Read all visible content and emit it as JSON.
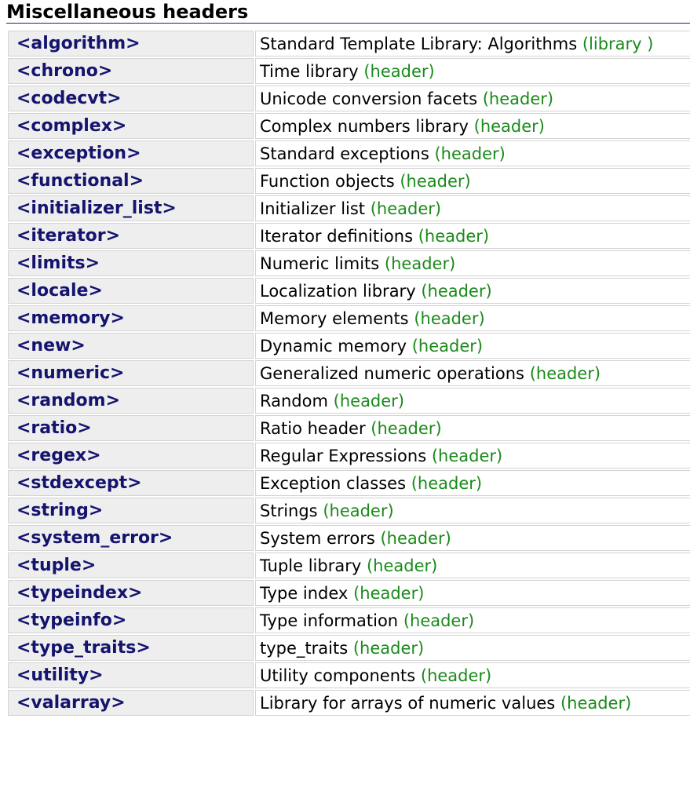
{
  "section": {
    "title": "Miscellaneous headers"
  },
  "colors": {
    "name_text": "#14146e",
    "kind_text": "#1a8a1a",
    "name_cell_bg": "#eeeeee",
    "cell_border": "#d3d3d3"
  },
  "rows": [
    {
      "name": "<algorithm>",
      "description": "Standard Template Library: Algorithms",
      "kind": "(library )"
    },
    {
      "name": "<chrono>",
      "description": "Time library",
      "kind": "(header)"
    },
    {
      "name": "<codecvt>",
      "description": "Unicode conversion facets",
      "kind": "(header)"
    },
    {
      "name": "<complex>",
      "description": "Complex numbers library",
      "kind": "(header)"
    },
    {
      "name": "<exception>",
      "description": "Standard exceptions",
      "kind": "(header)"
    },
    {
      "name": "<functional>",
      "description": "Function objects",
      "kind": "(header)"
    },
    {
      "name": "<initializer_list>",
      "description": "Initializer list",
      "kind": "(header)"
    },
    {
      "name": "<iterator>",
      "description": "Iterator definitions",
      "kind": "(header)"
    },
    {
      "name": "<limits>",
      "description": "Numeric limits",
      "kind": "(header)"
    },
    {
      "name": "<locale>",
      "description": "Localization library",
      "kind": "(header)"
    },
    {
      "name": "<memory>",
      "description": "Memory elements",
      "kind": "(header)"
    },
    {
      "name": "<new>",
      "description": "Dynamic memory",
      "kind": "(header)"
    },
    {
      "name": "<numeric>",
      "description": "Generalized numeric operations",
      "kind": "(header)"
    },
    {
      "name": "<random>",
      "description": "Random",
      "kind": "(header)"
    },
    {
      "name": "<ratio>",
      "description": "Ratio header",
      "kind": "(header)"
    },
    {
      "name": "<regex>",
      "description": "Regular Expressions",
      "kind": "(header)"
    },
    {
      "name": "<stdexcept>",
      "description": "Exception classes",
      "kind": "(header)"
    },
    {
      "name": "<string>",
      "description": "Strings",
      "kind": "(header)"
    },
    {
      "name": "<system_error>",
      "description": "System errors",
      "kind": "(header)"
    },
    {
      "name": "<tuple>",
      "description": "Tuple library",
      "kind": "(header)"
    },
    {
      "name": "<typeindex>",
      "description": "Type index",
      "kind": "(header)"
    },
    {
      "name": "<typeinfo>",
      "description": "Type information",
      "kind": "(header)"
    },
    {
      "name": "<type_traits>",
      "description": "type_traits",
      "kind": "(header)"
    },
    {
      "name": "<utility>",
      "description": "Utility components",
      "kind": "(header)"
    },
    {
      "name": "<valarray>",
      "description": "Library for arrays of numeric values",
      "kind": "(header)"
    }
  ]
}
